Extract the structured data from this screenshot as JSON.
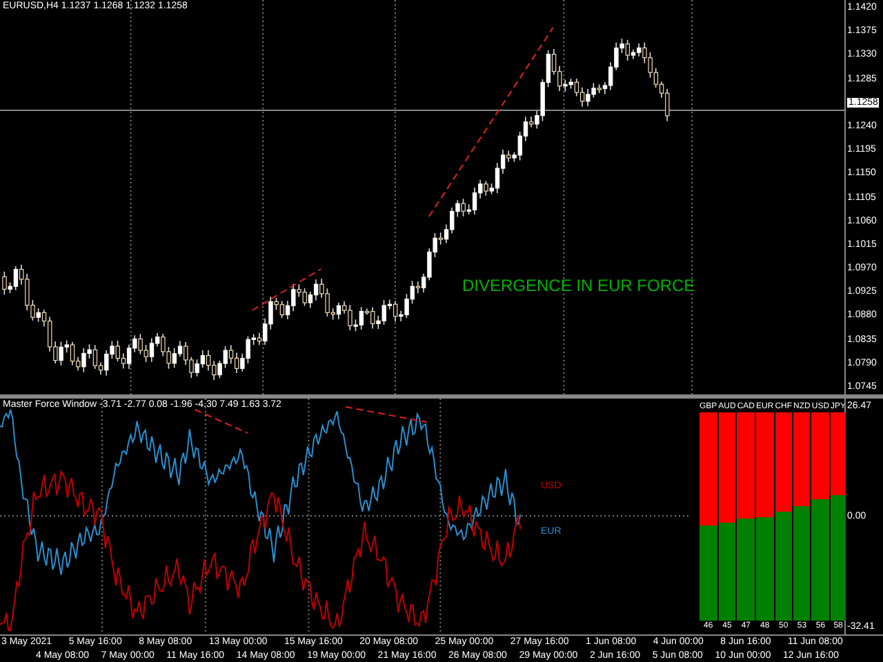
{
  "chart_title": "EURUSD,H4 1.1237 1.1268 1.1232 1.1258",
  "price_axis": [
    "1.1420",
    "1.1375",
    "1.1330",
    "1.1285",
    "1.1240",
    "1.1195",
    "1.1150",
    "1.1105",
    "1.1060",
    "1.1015",
    "1.0970",
    "1.0925",
    "1.0880",
    "1.0835",
    "1.0790",
    "1.0745"
  ],
  "current_price": "1.1258",
  "annotation": "DIVERGENCE IN EUR FORCE",
  "indicator": {
    "title": "Master Force Window -3.71 -2.77 0.08 -1.96 -4.30 7.49 1.63 3.72",
    "line_labels": [
      {
        "text": "USD",
        "color": "#c00000"
      },
      {
        "text": "EUR",
        "color": "#2a8fd0"
      }
    ],
    "axis": [
      "26.47",
      "0.00",
      "-32.41"
    ],
    "currencies": [
      {
        "name": "GBP",
        "value": "46",
        "level": 0.46
      },
      {
        "name": "AUD",
        "value": "45",
        "level": 0.47
      },
      {
        "name": "CAD",
        "value": "47",
        "level": 0.49
      },
      {
        "name": "EUR",
        "value": "48",
        "level": 0.5
      },
      {
        "name": "CHF",
        "value": "50",
        "level": 0.52
      },
      {
        "name": "NZD",
        "value": "53",
        "level": 0.55
      },
      {
        "name": "USD",
        "value": "56",
        "level": 0.58
      },
      {
        "name": "JPY",
        "value": "58",
        "level": 0.6
      }
    ]
  },
  "time_axis": [
    "3 May 2021",
    "4 May 08:00",
    "5 May 16:00",
    "7 May 00:00",
    "8 May 08:00",
    "11 May 16:00",
    "13 May 00:00",
    "14 May 08:00",
    "15 May 16:00",
    "19 May 00:00",
    "20 May 08:00",
    "21 May 16:00",
    "25 May 00:00",
    "26 May 08:00",
    "27 May 16:00",
    "29 May 00:00",
    "1 Jun 08:00",
    "2 Jun 16:00",
    "4 Jun 00:00",
    "5 Jun 08:00",
    "8 Jun 16:00",
    "10 Jun 00:00",
    "11 Jun 08:00",
    "12 Jun 16:00"
  ]
}
